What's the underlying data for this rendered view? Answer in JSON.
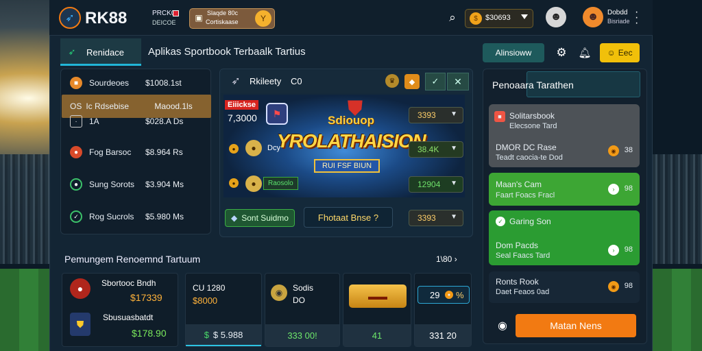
{
  "brand": {
    "name": "RK88",
    "promo_top": "PRCK0",
    "promo_bottom": "DEICOE"
  },
  "header": {
    "promo_card_top": "Slaqde 80c",
    "promo_card_bottom": "Cortiskaase",
    "balance": "$30693",
    "profile_1_top": "Dobdd",
    "profile_1_bottom": "Bisriade"
  },
  "nav": {
    "active_tab": "Renidace",
    "page_title": "Aplikas Sportbook Terbaalk Tartius",
    "action_button": "Alinsioww",
    "cta_button": "Eec"
  },
  "sports_list": [
    {
      "name": "Sourdeoes",
      "value": "$1008.1st"
    },
    {
      "name": "Ic Rdsebise",
      "value": "Maood.1ls"
    },
    {
      "name": "1A",
      "value": "$028.A Ds"
    },
    {
      "name": "Fog Barsoc",
      "value": "$8.964 Rs"
    },
    {
      "name": "Sung Sorots",
      "value": "$3.904 Ms"
    },
    {
      "name": "Rog Sucrols",
      "value": "$5.980 Ms"
    }
  ],
  "sports_list_prefix": "OS",
  "match": {
    "header_title": "Rkileety",
    "header_num": "C0",
    "badge": "Eiiickse",
    "score": "7,3000",
    "banner_title": "YROLATHAISION",
    "banner_top": "Sdiouop",
    "banner_sub": "RUI FSF BIUN",
    "icon_text": "Dcy",
    "team_chip": "Raosolo",
    "odds": [
      "3393",
      "38.4K",
      "12904",
      "3393"
    ],
    "chip_btn": "Sont Suidmo",
    "cta_btn": "Fhotaat Bnse ?"
  },
  "right": {
    "title": "Penoaara Tarathen",
    "cards": [
      {
        "t1": "Solitarsbook",
        "t2": "Elecsone Tard",
        "t3": "DMOR DC Rase",
        "t4": "Teadt caocia-te Dod",
        "num": "38"
      },
      {
        "t1": "Maan's Cam",
        "t2": "Faart Foacs Fracl",
        "num": "98"
      },
      {
        "t1": "Garing Son",
        "t2": "Dom Pacds",
        "t3": "Seal Faacs Tard",
        "num": "98"
      },
      {
        "t1": "Ronts Rook",
        "t2": "Daet Feaos 0ad",
        "num": "98"
      }
    ],
    "bottom_btn": "Matan Nens"
  },
  "recent": {
    "title": "Pemungem Renoemnd Tartuum",
    "more": "1\\80",
    "cards": [
      {
        "name": "Sbortooc Bndh",
        "value": "$17339"
      },
      {
        "name": "Sbusuasbatdt",
        "value": "$178.90"
      }
    ],
    "mid_top": "CU 1280",
    "mid_val": "$8000",
    "mid_strip": "$ 5.988",
    "mid2_top": "Sodis",
    "mid2_bot": "DO",
    "mid2_strip": "333 00!",
    "mid3_strip": "41",
    "mid4_top": "29",
    "mid4_pct": "%",
    "mid4_strip": "331 20"
  },
  "colors": {
    "accent_orange": "#f27a12",
    "accent_green": "#3fae2e",
    "teal": "#1c5d60",
    "gold": "#f1c00a"
  }
}
